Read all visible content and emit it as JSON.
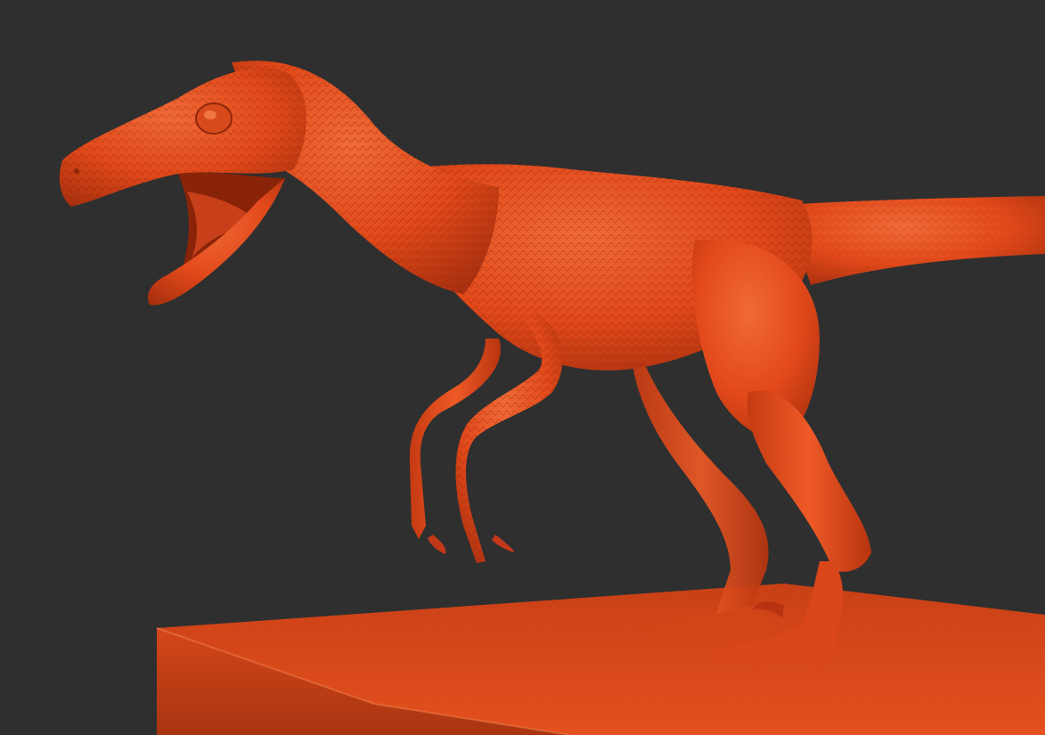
{
  "scene": {
    "subject": "raptor-sculpt",
    "colors": {
      "background": "#2f2f2f",
      "clay": "#e2491a",
      "clay_highlight": "#f06a36",
      "clay_shadow": "#a9300e",
      "base_top": "#d9461a",
      "base_side": "#b83a12"
    }
  }
}
